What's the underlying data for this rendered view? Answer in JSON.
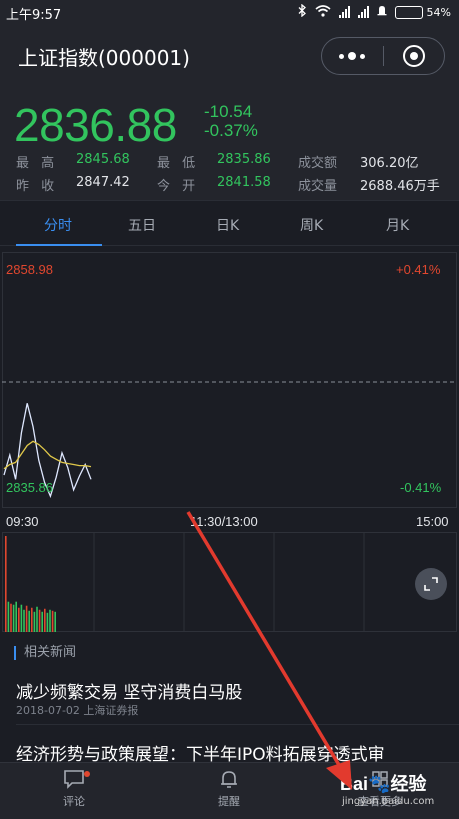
{
  "status": {
    "time": "上午9:57",
    "battery": "54%",
    "battery_level": 0.54
  },
  "header": {
    "title": "上证指数(000001)"
  },
  "quote": {
    "price": "2836.88",
    "change": "-10.54",
    "change_pct": "-0.37%",
    "high_label": "最 高",
    "high": "2845.68",
    "low_label": "最 低",
    "low": "2835.86",
    "amount_label": "成交额",
    "amount": "306.20亿",
    "prev_close_label": "昨 收",
    "prev_close": "2847.42",
    "open_label": "今 开",
    "open": "2841.58",
    "volume_label": "成交量",
    "volume": "2688.46万手"
  },
  "tabs": [
    "分时",
    "五日",
    "日K",
    "周K",
    "月K"
  ],
  "active_tab": 0,
  "chart_data": {
    "type": "line",
    "y_top": "2858.98",
    "y_bottom": "2835.86",
    "pct_top": "+0.41%",
    "pct_bottom": "-0.41%",
    "x_ticks": [
      "09:30",
      "11:30/13:00",
      "15:00"
    ],
    "reference_price": 2847.42,
    "ylim": [
      2835.86,
      2858.98
    ],
    "series": [
      {
        "color": "#dfe8ff",
        "values": [
          2838.6,
          2840.5,
          2838.2,
          2842.6,
          2845.4,
          2843.2,
          2840.0,
          2837.9,
          2836.6,
          2838.4,
          2840.7,
          2839.3,
          2837.2,
          2838.5,
          2839.6,
          2838.2
        ]
      },
      {
        "color": "#e0c84a",
        "values": [
          2839.2,
          2839.6,
          2839.8,
          2840.6,
          2841.4,
          2841.8,
          2841.5,
          2841.0,
          2840.4,
          2840.1,
          2839.8,
          2839.7,
          2839.6,
          2839.5,
          2839.5,
          2839.4
        ]
      }
    ],
    "volume": [
      95,
      30,
      28,
      27,
      30,
      24,
      27,
      22,
      26,
      21,
      24,
      20,
      25,
      22,
      20,
      23,
      19,
      22,
      21,
      20
    ],
    "volume_up": [
      true,
      false,
      true,
      false,
      false,
      true,
      false,
      false,
      true,
      false,
      true,
      false,
      false,
      true,
      false,
      true,
      false,
      false,
      true,
      false
    ]
  },
  "news": {
    "header": "相关新闻",
    "items": [
      {
        "title": "减少频繁交易 坚守消费白马股",
        "meta": "2018-07-02 上海证券报"
      },
      {
        "title": "经济形势与政策展望：下半年IPO料拓展穿透式审",
        "meta": ""
      }
    ]
  },
  "bottom": {
    "comment": "评论",
    "remind": "提醒",
    "more": "查看更多"
  },
  "watermark": {
    "brand": "Bai",
    "suffix": "经验",
    "url": "jingyan.baidu.com"
  },
  "colors": {
    "up": "#e0472f",
    "down": "#32c45e",
    "accent": "#3a8ef0"
  }
}
